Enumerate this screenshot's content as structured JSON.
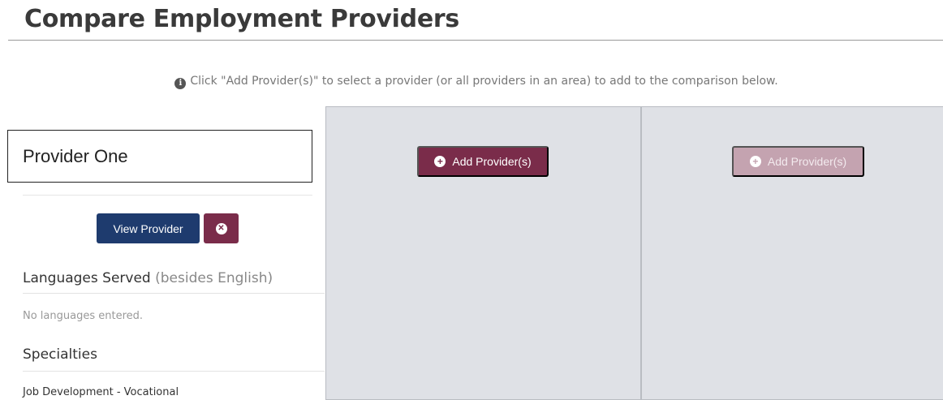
{
  "page": {
    "title": "Compare Employment Providers"
  },
  "info": {
    "icon": "info-circle-icon",
    "text": "Click \"Add Provider(s)\" to select a provider (or all providers in an area) to add to the comparison below."
  },
  "provider": {
    "name": "Provider One",
    "view_label": "View Provider",
    "remove_icon": "close-circle-icon",
    "languages": {
      "title": "Languages Served",
      "title_note": "(besides English)",
      "value": "No languages entered."
    },
    "specialties": {
      "title": "Specialties",
      "value": "Job Development - Vocational"
    }
  },
  "slots": [
    {
      "add_label": "Add Provider(s)",
      "state": "enabled"
    },
    {
      "add_label": "Add Provider(s)",
      "state": "disabled"
    }
  ],
  "colors": {
    "primary_navy": "#1e3b6e",
    "accent_plum": "#7a2c4a",
    "accent_plum_disabled": "#c4a3b0",
    "slot_background": "#dfe1e6"
  }
}
